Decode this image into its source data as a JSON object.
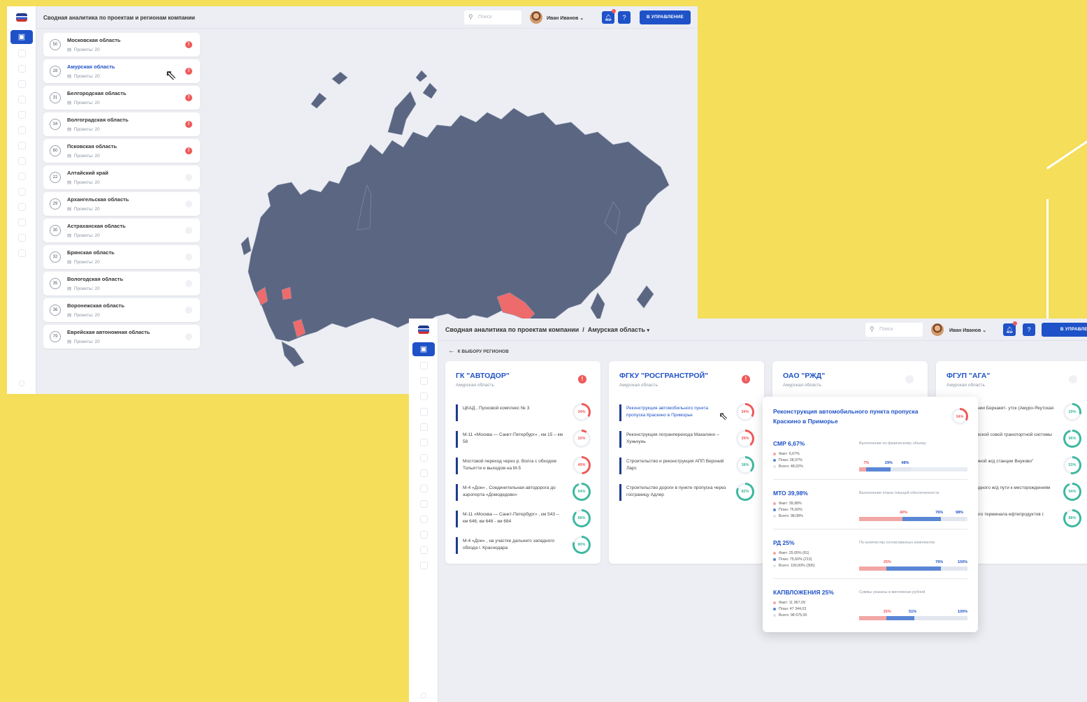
{
  "window1": {
    "header_title": "Сводная аналитика по проектам и регионам компании",
    "search_placeholder": "Поиск",
    "user_name": "Иван Иванов",
    "manage_button": "В УПРАВЛЕНИЕ",
    "regions": [
      {
        "num": "50",
        "name": "Московская область",
        "projects": "Проекты:  20",
        "warn": true
      },
      {
        "num": "28",
        "name": "Амурская область",
        "projects": "Проекты:  20",
        "warn": true
      },
      {
        "num": "31",
        "name": "Белгородская область",
        "projects": "Проекты:  20",
        "warn": true
      },
      {
        "num": "34",
        "name": "Волгоградская область",
        "projects": "Проекты:  20",
        "warn": true
      },
      {
        "num": "60",
        "name": "Псковская область",
        "projects": "Проекты:  20",
        "warn": true
      },
      {
        "num": "22",
        "name": "Алтайский край",
        "projects": "Проекты:  20",
        "warn": false
      },
      {
        "num": "29",
        "name": "Архангельская область",
        "projects": "Проекты:  20",
        "warn": false
      },
      {
        "num": "30",
        "name": "Астраханская область",
        "projects": "Проекты:  20",
        "warn": false
      },
      {
        "num": "32",
        "name": "Брянская область",
        "projects": "Проекты:  20",
        "warn": false
      },
      {
        "num": "35",
        "name": "Вологодская область",
        "projects": "Проекты:  20",
        "warn": false
      },
      {
        "num": "36",
        "name": "Воронежская область",
        "projects": "Проекты:  20",
        "warn": false
      },
      {
        "num": "79",
        "name": "Еврейская автономная область",
        "projects": "Проекты:  20",
        "warn": false
      }
    ]
  },
  "window2": {
    "breadcrumb_root": "Сводная аналитика по проектам компании",
    "breadcrumb_sep": "/",
    "breadcrumb_region": "Амурская область",
    "search_placeholder": "Поиск",
    "user_name": "Иван Иванов",
    "manage_button": "В УПРАВЛЕНИЕ",
    "back_label": "К ВЫБОРУ РЕГИОНОВ",
    "cards": [
      {
        "name": "ГК \"АВТОДОР\"",
        "region": "Амурская область",
        "warn": true,
        "projects": [
          {
            "text": "ЦКАД , Пусковой комплекс № 3",
            "pct": "34%",
            "val": 34,
            "color": "#ee5a5a"
          },
          {
            "text": "М-11 «Москва — Санкт-Петербург» , км 15 – км 58",
            "pct": "10%",
            "val": 10,
            "color": "#ee5a5a"
          },
          {
            "text": "Мостовой переход через р. Волга с обходом Тольятти и выходом на М-5",
            "pct": "49%",
            "val": 49,
            "color": "#ee5a5a"
          },
          {
            "text": "М-4 «Дон» , Соединительная автодорога до аэропорта «Домодедово»",
            "pct": "94%",
            "val": 94,
            "color": "#3db8a0"
          },
          {
            "text": "М-11 «Москва — Санкт-Петербург» , км 543 – км 646, км 646 - км 684",
            "pct": "88%",
            "val": 88,
            "color": "#3db8a0"
          },
          {
            "text": "М-4 «Дон» , на участке дальнего западного обхода г. Краснодара",
            "pct": "80%",
            "val": 80,
            "color": "#3db8a0"
          }
        ]
      },
      {
        "name": "ФГКУ \"РОСГРАНСТРОЙ\"",
        "region": "Амурская область",
        "warn": true,
        "projects": [
          {
            "text": "Реконструкция автомобильного пункта пропуска Краскино в Приморье",
            "pct": "34%",
            "val": 34,
            "color": "#ee5a5a"
          },
          {
            "text": "Реконструкция погранперехода Махалино – Хуньчунь",
            "pct": "39%",
            "val": 39,
            "color": "#ee5a5a"
          },
          {
            "text": "Строительство и реконструкция АПП Верхний Ларс",
            "pct": "38%",
            "val": 38,
            "color": "#3db8a0"
          },
          {
            "text": "Строительство дороги в пункте пропуска через госграницу Адлер",
            "pct": "82%",
            "val": 82,
            "color": "#3db8a0"
          }
        ]
      },
      {
        "name": "ОАО \"РЖД\"",
        "region": "Амурская область",
        "warn": false,
        "projects": []
      },
      {
        "name": "ФГУП \"АГА\"",
        "region": "Амурская область",
        "warn": false,
        "projects": [
          {
            "text": "ство ж/д линии Беркакит- утск (Амуро-Якутская магист...",
            "pct": "29%",
            "val": 29,
            "color": "#3db8a0"
          },
          {
            "text": "ство Московской совой транспортной системы",
            "pct": "96%",
            "val": 96,
            "color": "#3db8a0"
          },
          {
            "text": "ство подземной ж/д станции Внуково\"",
            "pct": "53%",
            "val": 53,
            "color": "#3db8a0"
          },
          {
            "text": "ство подъездного ж/д пути к месторождениям Улак-Эльга",
            "pct": "94%",
            "val": 94,
            "color": "#3db8a0"
          },
          {
            "text": "ство морского терминала ефтепродуктов г. Приморск",
            "pct": "88%",
            "val": 88,
            "color": "#3db8a0"
          }
        ]
      }
    ],
    "popup": {
      "title": "Реконструкция автомобильного пункта пропуска Краскино в Приморье",
      "pct": "34%",
      "metrics": [
        {
          "name": "СМР  6,67%",
          "desc": "Выполнение по физическому объему",
          "legend": [
            "Факт: 6,67%",
            "План: 28,97%",
            "Всего: 48,02%"
          ],
          "labels": [
            "7%",
            "29%",
            "48%"
          ],
          "fact": 6.67,
          "plan": 28.97,
          "total": 48.02
        },
        {
          "name": "МТО  39,98%",
          "desc": "Выполнение плана текущей обеспеченности",
          "legend": [
            "Факт: 39,98%",
            "План: 75,60%",
            "Всего: 98,08%"
          ],
          "labels": [
            "40%",
            "76%",
            "98%"
          ],
          "fact": 39.98,
          "plan": 75.6,
          "total": 98.08
        },
        {
          "name": "РД  25%",
          "desc": "По количеству согласованных комплектов",
          "legend": [
            "Факт: 25,05% (81)",
            "План: 75,60% (213)",
            "Всего: 100,00% (305)"
          ],
          "labels": [
            "25%",
            "76%",
            "100%"
          ],
          "fact": 25.05,
          "plan": 75.6,
          "total": 100
        },
        {
          "name": "КАПВЛОЖЕНИЯ  25%",
          "desc": "Суммы указаны в миллионах рублей",
          "legend": [
            "Факт: 11 967,09",
            "План: 47 344,03",
            "Всего: 98 675,00"
          ],
          "labels": [
            "25%",
            "51%",
            "100%"
          ],
          "fact": 25,
          "plan": 51,
          "total": 100
        }
      ]
    }
  },
  "colors": {
    "accent": "#1f52c8",
    "warning": "#ee5a5a",
    "ok": "#3db8a0",
    "map": "#5a6682"
  }
}
